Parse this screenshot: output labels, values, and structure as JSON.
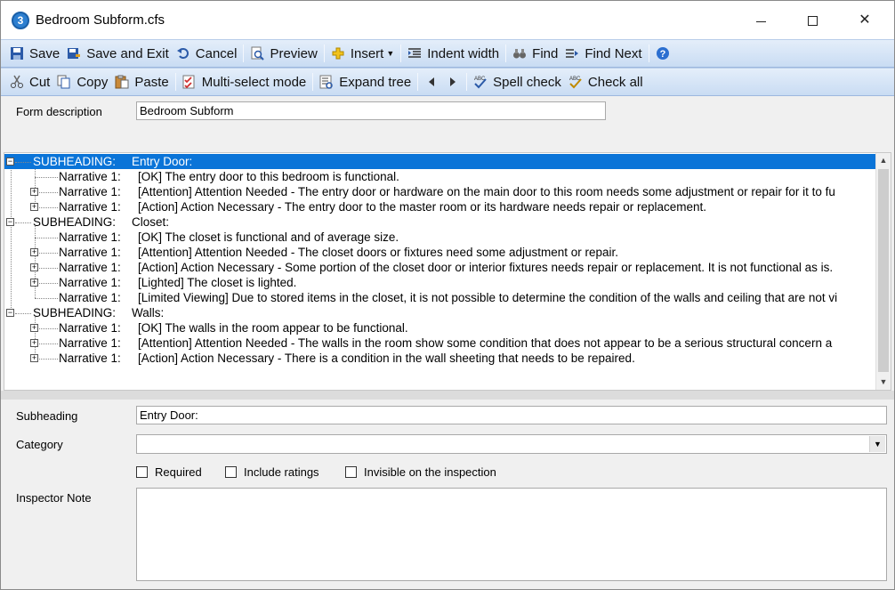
{
  "window": {
    "title": "Bedroom Subform.cfs",
    "app_icon_glyph": "3"
  },
  "toolbar1": {
    "save": "Save",
    "save_exit": "Save and Exit",
    "cancel": "Cancel",
    "preview": "Preview",
    "insert": "Insert",
    "indent_width": "Indent width",
    "find": "Find",
    "find_next": "Find Next"
  },
  "toolbar2": {
    "cut": "Cut",
    "copy": "Copy",
    "paste": "Paste",
    "multi_select": "Multi-select mode",
    "expand_tree": "Expand tree",
    "spell_check": "Spell check",
    "check_all": "Check all"
  },
  "form": {
    "description_label": "Form description",
    "description_value": "Bedroom Subform"
  },
  "tree": {
    "rows": [
      {
        "type": "SUBHEADING:",
        "label": "Entry Door:"
      },
      {
        "type": "Narrative 1:",
        "label": "[OK]  The entry door to this bedroom is functional."
      },
      {
        "type": "Narrative 1:",
        "label": "[Attention]  Attention Needed - The entry door or hardware on the main door to this room needs some adjustment or repair for it to fu"
      },
      {
        "type": "Narrative 1:",
        "label": "[Action]  Action Necessary - The entry door to the master room or its hardware needs repair or replacement."
      },
      {
        "type": "SUBHEADING:",
        "label": "Closet:"
      },
      {
        "type": "Narrative 1:",
        "label": "[OK]  The closet is functional and of average size."
      },
      {
        "type": "Narrative 1:",
        "label": "[Attention]  Attention Needed - The closet doors or fixtures need some adjustment or repair."
      },
      {
        "type": "Narrative 1:",
        "label": "[Action]  Action Necessary - Some portion of the closet door or interior fixtures needs repair or replacement.  It is not functional as is."
      },
      {
        "type": "Narrative 1:",
        "label": "[Lighted]  The closet is lighted."
      },
      {
        "type": "Narrative 1:",
        "label": "[Limited Viewing]  Due to stored items in the closet, it is not possible to determine the condition of the walls and ceiling that are not vi"
      },
      {
        "type": "SUBHEADING:",
        "label": "Walls:"
      },
      {
        "type": "Narrative 1:",
        "label": "[OK]  The walls in the room appear to be functional."
      },
      {
        "type": "Narrative 1:",
        "label": "[Attention]  Attention Needed  - The walls in the room show some condition that does not appear to be a serious structural concern a"
      },
      {
        "type": "Narrative 1:",
        "label": "[Action]  Action Necessary - There is a condition in the wall sheeting that needs to be repaired."
      }
    ]
  },
  "details": {
    "subheading_label": "Subheading",
    "subheading_value": "Entry Door:",
    "category_label": "Category",
    "category_value": "",
    "required_label": "Required",
    "include_ratings_label": "Include ratings",
    "invisible_label": "Invisible on the inspection",
    "inspector_note_label": "Inspector Note",
    "inspector_note_value": ""
  }
}
